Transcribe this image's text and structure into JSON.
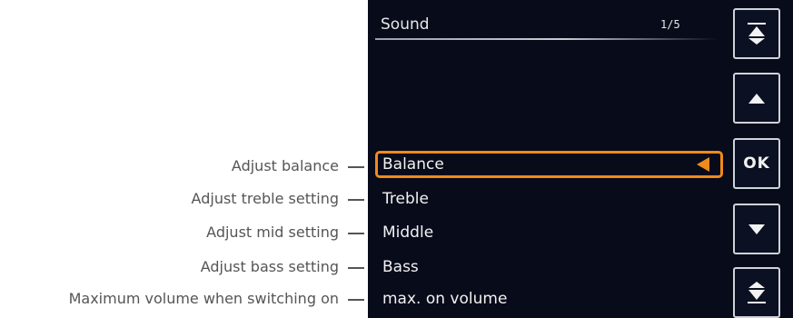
{
  "annotations": [
    "Adjust balance",
    "Adjust treble setting",
    "Adjust mid setting",
    "Adjust bass setting",
    "Maximum volume when switching on"
  ],
  "screen": {
    "title": "Sound",
    "page_indicator": "1/5",
    "menu_items": [
      "Balance",
      "Treble",
      "Middle",
      "Bass",
      "max. on volume"
    ],
    "selected_item": "Balance",
    "highlight_color": "#f08a1c",
    "background_color": "#070b1a"
  },
  "buttons": {
    "top_icon": "chevron-top-icon",
    "up_icon": "arrow-up-icon",
    "ok_label": "OK",
    "down_icon": "arrow-down-icon",
    "bottom_icon": "chevron-bottom-icon"
  }
}
